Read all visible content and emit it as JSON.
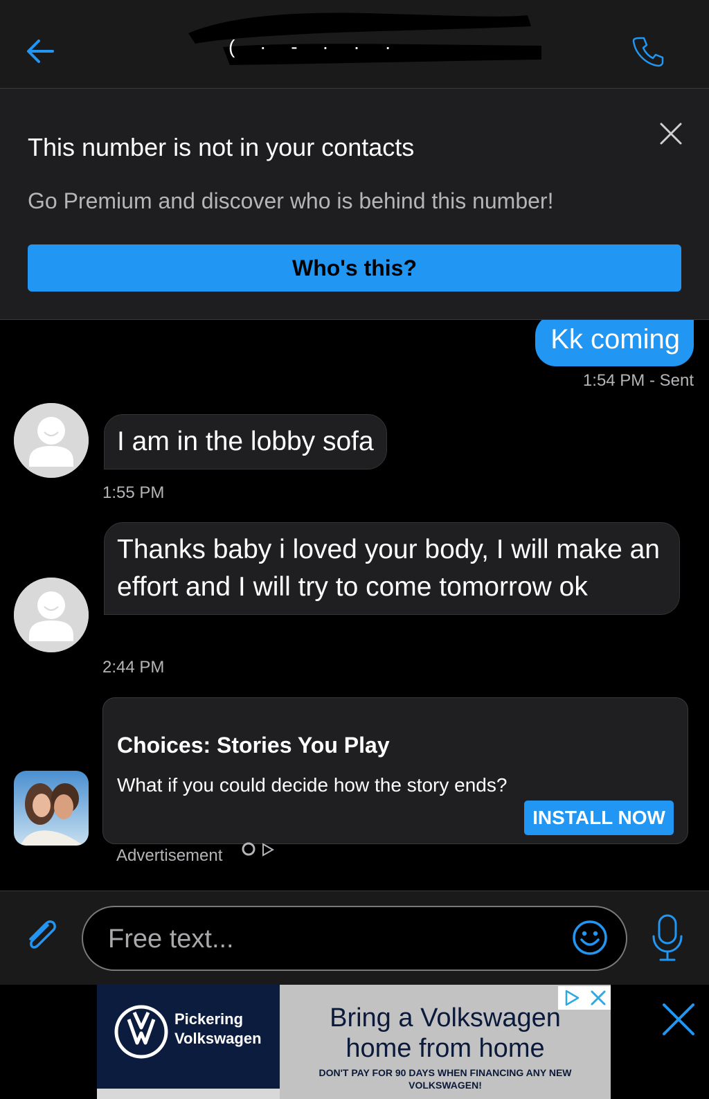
{
  "header": {
    "title_redacted": "(  ·  -  ·  ·  ·",
    "back_icon": "arrow-left-icon",
    "call_icon": "phone-icon"
  },
  "banner": {
    "title": "This number is not in your contacts",
    "subtitle": "Go Premium and discover who is behind this number!",
    "button_label": "Who's this?",
    "close_icon": "close-icon"
  },
  "messages": [
    {
      "direction": "sent",
      "text": "Kk coming",
      "meta": "1:54 PM - Sent"
    },
    {
      "direction": "received",
      "text": "I am in the lobby sofa",
      "time": "1:55 PM"
    },
    {
      "direction": "received",
      "text": "Thanks baby i loved your body, I will make an effort and I will try to come tomorrow ok",
      "time": "2:44 PM"
    }
  ],
  "inline_ad": {
    "title": "Choices: Stories You Play",
    "description": "What if you could decide how the story ends?",
    "cta": "INSTALL NOW",
    "label": "Advertisement"
  },
  "composer": {
    "placeholder": "Free text...",
    "attach_icon": "paperclip-icon",
    "emoji_icon": "smiley-icon",
    "mic_icon": "microphone-icon"
  },
  "bottom_ad": {
    "brand_line1": "Pickering",
    "brand_line2": "Volkswagen",
    "headline_line1": "Bring a Volkswagen",
    "headline_line2": "home from home",
    "fine_print": "DON'T PAY FOR 90 DAYS WHEN FINANCING ANY NEW VOLKSWAGEN!"
  },
  "colors": {
    "accent": "#2196f3",
    "background": "#000000",
    "surface": "#1a1a1b",
    "bubble_received": "#1f1f21",
    "muted_text": "#b5b5b8"
  }
}
